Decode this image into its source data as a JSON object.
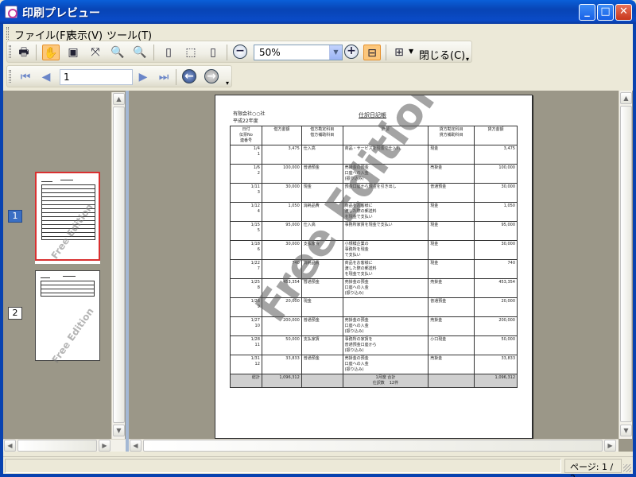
{
  "window": {
    "title": "印刷プレビュー",
    "controls": {
      "minimize": "_",
      "maximize": "□",
      "close": "✕"
    }
  },
  "menu": [
    "ファイル(F)",
    "表示(V)",
    "ツール(T)"
  ],
  "toolbar": {
    "zoom_value": "50%",
    "close_label": "閉じる(C)",
    "icons": [
      "print-icon",
      "hand-icon",
      "snapshot-icon",
      "zoom-tool-icon",
      "zoom-out-tool-icon",
      "zoom-in-tool-icon",
      "single-page-icon",
      "page-border-icon",
      "page-setup-icon",
      "zoom-minus-icon",
      "zoom-plus-icon",
      "fit-page-icon",
      "multi-page-icon"
    ]
  },
  "nav": {
    "page_input": "1",
    "icons": [
      "first-page-icon",
      "prev-page-icon",
      "next-page-icon",
      "last-page-icon",
      "back-icon",
      "forward-icon"
    ]
  },
  "thumbnails": [
    {
      "number": "1",
      "watermark": "Free Edition",
      "selected": true
    },
    {
      "number": "2",
      "watermark": "Free Edition",
      "selected": false
    }
  ],
  "page": {
    "company": "有限会社○○社",
    "fiscal_year": "平成22年度",
    "title": "仕訳日記帳",
    "watermark": "Free Edition",
    "headers": [
      "日付\n伝票No\n連番号",
      "借方金額",
      "借方勘定科目\n借方補助科目",
      "摘要",
      "貸方勘定科目\n貸方補助科目",
      "貸方金額"
    ],
    "rows": [
      {
        "date": "1/4\n1",
        "debit_amt": "3,475",
        "debit_acct": "仕入高",
        "memo": "商品・サービスを現金で仕入れ",
        "credit_acct": "現金",
        "credit_amt": "3,475"
      },
      {
        "date": "1/6\n2",
        "debit_amt": "100,000",
        "debit_acct": "普通預金",
        "memo": "売掛金の預金\n口座への入金\n(振り込み)",
        "credit_acct": "売掛金",
        "credit_amt": "100,000"
      },
      {
        "date": "1/11\n3",
        "debit_amt": "30,000",
        "debit_acct": "現金",
        "memo": "預金口座から現金を引き出し",
        "credit_acct": "普通預金",
        "credit_amt": "30,000"
      },
      {
        "date": "1/12\n4",
        "debit_amt": "1,050",
        "debit_acct": "消耗品費",
        "memo": "商品をお客様に\n渡した際の郵送料\nを現金で支払い",
        "credit_acct": "現金",
        "credit_amt": "1,050"
      },
      {
        "date": "1/15\n5",
        "debit_amt": "95,000",
        "debit_acct": "仕入高",
        "memo": "事務所家賃を現金で支払い",
        "credit_acct": "現金",
        "credit_amt": "95,000"
      },
      {
        "date": "1/18\n6",
        "debit_amt": "30,000",
        "debit_acct": "支払家賃",
        "memo": "小規模企業の\n事務所を現金\nで支払い",
        "credit_acct": "現金",
        "credit_amt": "30,000"
      },
      {
        "date": "1/22\n7",
        "debit_amt": "740",
        "debit_acct": "消耗品費",
        "memo": "商品をお客様に\n渡した際の郵送料\nを現金で支払い",
        "credit_acct": "現金",
        "credit_amt": "740"
      },
      {
        "date": "1/25\n8",
        "debit_amt": "453,354",
        "debit_acct": "普通預金",
        "memo": "売掛金の預金\n口座への入金\n(振り込み)",
        "credit_acct": "売掛金",
        "credit_amt": "453,354"
      },
      {
        "date": "1/26\n9",
        "debit_amt": "20,000",
        "debit_acct": "現金",
        "memo": "",
        "credit_acct": "普通預金",
        "credit_amt": "20,000"
      },
      {
        "date": "1/27\n10",
        "debit_amt": "200,000",
        "debit_acct": "普通預金",
        "memo": "売掛金の預金\n口座への入金\n(振り込み)",
        "credit_acct": "売掛金",
        "credit_amt": "200,000"
      },
      {
        "date": "1/28\n11",
        "debit_amt": "50,000",
        "debit_acct": "支払家賃",
        "memo": "事務所の家賃を\n普通預金口座から\n(振り込み)",
        "credit_acct": "小口現金",
        "credit_amt": "50,000"
      },
      {
        "date": "1/31\n12",
        "debit_amt": "33,833",
        "debit_acct": "普通預金",
        "memo": "売掛金の預金\n口座への入金\n(振り込み)",
        "credit_acct": "売掛金",
        "credit_amt": "33,833"
      }
    ],
    "total": {
      "label": "総計",
      "debit": "1,096,312",
      "memo": "1月度 合計",
      "count_label": "仕訳数",
      "count": "12件",
      "credit": "1,096,312"
    }
  },
  "status": {
    "page_indicator": "ページ: 1 / 2"
  },
  "colors": {
    "title_bar": "#0a4bc7",
    "active_tool": "#fcc77b",
    "selected_thumb_border": "#d93030",
    "selected_number": "#3a6fc4"
  }
}
